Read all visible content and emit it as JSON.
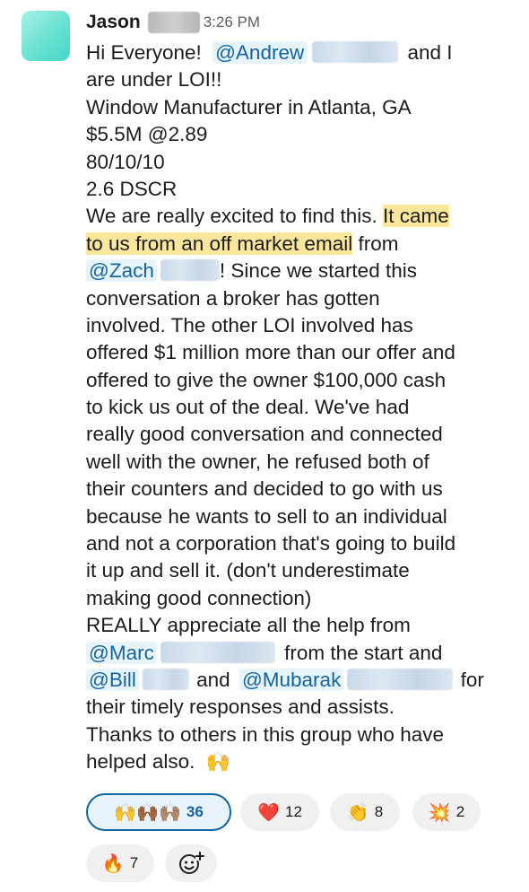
{
  "message": {
    "sender": "Jason",
    "time": "3:26 PM",
    "text": {
      "l1_pre": "Hi Everyone!",
      "l1_mention": "@Andrew",
      "l1_post": "and I",
      "l2": "are under LOI!!",
      "l3": "Window Manufacturer in Atlanta, GA",
      "l4": "$5.5M @2.89",
      "l5": "80/10/10",
      "l6": "2.6 DSCR",
      "l7_pre": "We are really excited to find this. ",
      "l7_hl": "It came",
      "l8_hl": "to us from an off market email",
      "l8_post": " from",
      "l9_mention": "@Zach",
      "l9_post": "! Since we started this",
      "l10": "conversation a broker has gotten",
      "l11": "involved. The other LOI involved has",
      "l12": "offered $1 million more than our offer and",
      "l13": "offered to give the owner $100,000 cash",
      "l14": "to kick us out of the deal. We've had",
      "l15": "really good conversation and connected",
      "l16": "well with the owner, he refused both of",
      "l17": "their counters and decided to go with us",
      "l18": "because he wants to sell to an individual",
      "l19": "and not a corporation that's going to build",
      "l20": "it up and sell it.  (don't underestimate",
      "l21": "making good connection)",
      "l22": "REALLY appreciate all the help from",
      "l23_mention": "@Marc",
      "l23_post": "from the start and",
      "l24_mention1": "@Bill",
      "l24_and": "and",
      "l24_mention2": "@Mubarak",
      "l24_post": "for",
      "l25": "their timely responses and assists.",
      "l26": "Thanks to others in this group who have",
      "l27": "helped also.",
      "l27_emoji": "🙌"
    }
  },
  "reactions": [
    {
      "emoji": "🙌🙌🏾🙌🏽",
      "count": "36",
      "active": true
    },
    {
      "emoji": "❤️",
      "count": "12",
      "active": false
    },
    {
      "emoji": "👏",
      "count": "8",
      "active": false
    },
    {
      "emoji": "💥",
      "count": "2",
      "active": false
    },
    {
      "emoji": "🔥",
      "count": "7",
      "active": false
    }
  ],
  "add_reaction_icon": "add-reaction-icon",
  "colors": {
    "mention": "#1264a3",
    "highlight": "#fbe79b",
    "avatar": "#63e0d0"
  }
}
